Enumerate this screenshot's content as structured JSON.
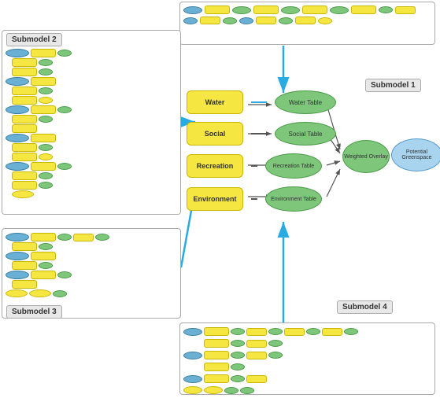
{
  "submodels": {
    "sm1": {
      "label": "Submodel 1"
    },
    "sm2": {
      "label": "Submodel 2"
    },
    "sm3": {
      "label": "Submodel 3"
    },
    "sm4": {
      "label": "Submodel 4"
    }
  },
  "center_nodes": {
    "water": "Water",
    "water_table": "Water Table",
    "social": "Social",
    "social_table": "Social Table",
    "recreation": "Recreation",
    "recreation_table": "Recreation\nTable",
    "environment": "Environment",
    "environment_table": "Environment\nTable",
    "weighted_overlay": "Weighted\nOverlay",
    "potential_greenspace": "Potential\nGreenspace"
  },
  "colors": {
    "arrow_blue": "#29abe2",
    "rect_yellow": "#f5e642",
    "ellipse_green": "#7dc67a",
    "ellipse_blue": "#6ab0d4",
    "submodel_border": "#aaaaaa"
  }
}
